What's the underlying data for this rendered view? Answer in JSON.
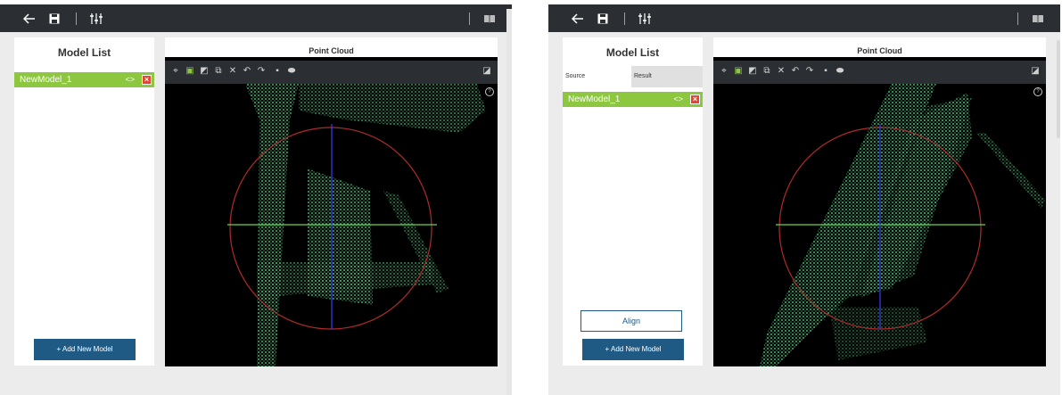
{
  "windows": [
    {
      "model_list_title": "Model List",
      "models": [
        {
          "label": "NewModel_1"
        }
      ],
      "add_button": "+ Add New Model",
      "cloud_title": "Point Cloud"
    },
    {
      "model_list_title": "Model List",
      "tabs": [
        {
          "label": "Source"
        },
        {
          "label": "Result"
        }
      ],
      "models": [
        {
          "label": "NewModel_1"
        }
      ],
      "align_button": "Align",
      "add_button": "+ Add New Model",
      "cloud_title": "Point Cloud"
    }
  ],
  "icons": {
    "back": "arrow-left-icon",
    "save": "save-icon",
    "equalizer": "sliders-icon",
    "book": "book-icon",
    "code": "code-icon",
    "delete": "delete-icon",
    "help": "help-icon"
  },
  "colors": {
    "topbar": "#2b2f33",
    "accent_green": "#8dc63f",
    "button_blue": "#1e5a84",
    "delete_red": "#e8432e",
    "cloud_green": "#3fb870",
    "sphere_red": "#b02a2a",
    "axis_blue": "#3c3cff",
    "axis_green": "#6ad44b"
  }
}
